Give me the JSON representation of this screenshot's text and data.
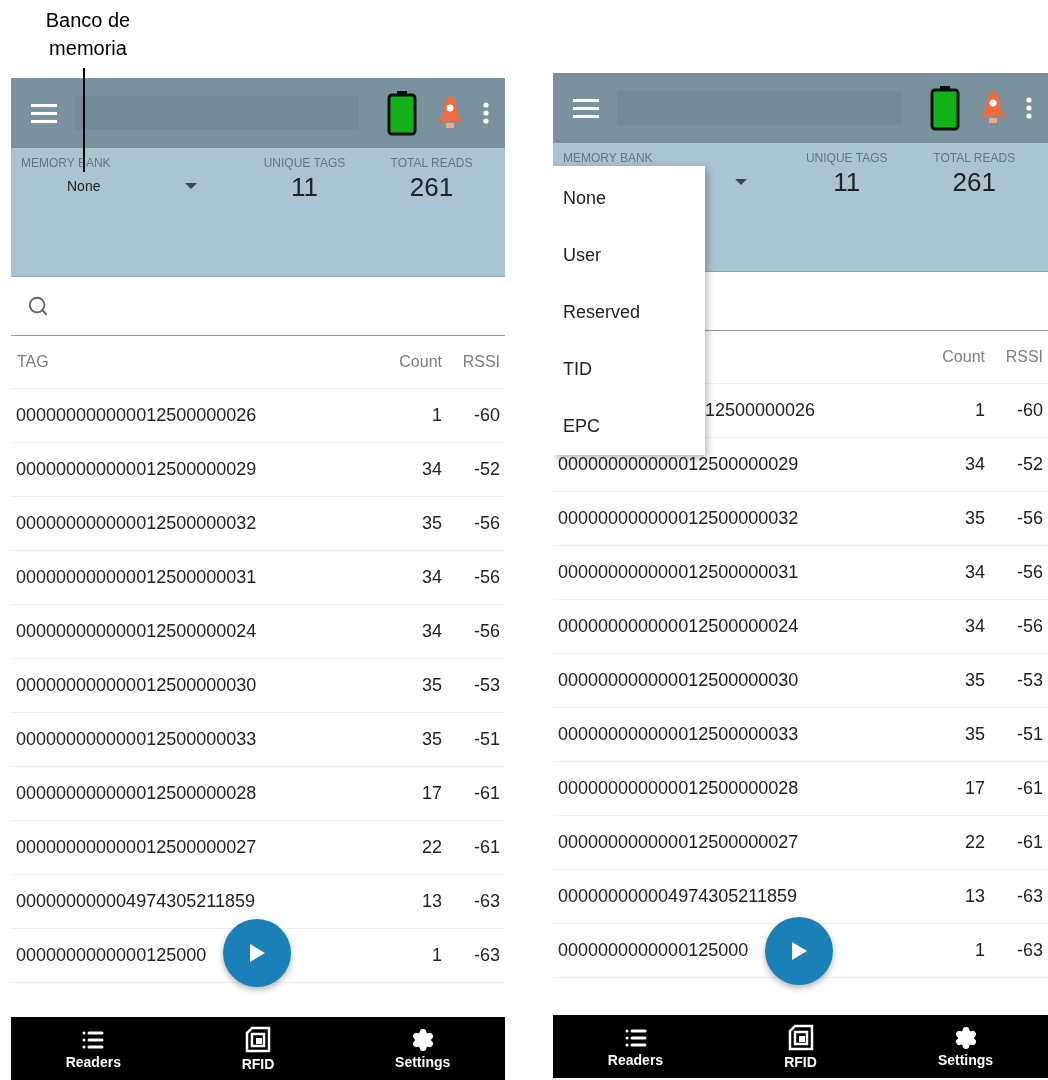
{
  "annotation": {
    "label": "Banco de memoria"
  },
  "screens": [
    {
      "memory_bank": {
        "label": "MEMORY BANK",
        "value": "None"
      },
      "unique_tags": {
        "label": "UNIQUE TAGS",
        "value": "11"
      },
      "total_reads": {
        "label": "TOTAL READS",
        "value": "261"
      },
      "columns": {
        "tag": "TAG",
        "count": "Count",
        "rssi": "RSSI"
      },
      "rows": [
        {
          "tag": "000000000000012500000026",
          "count": "1",
          "rssi": "-60"
        },
        {
          "tag": "000000000000012500000029",
          "count": "34",
          "rssi": "-52"
        },
        {
          "tag": "000000000000012500000032",
          "count": "35",
          "rssi": "-56"
        },
        {
          "tag": "000000000000012500000031",
          "count": "34",
          "rssi": "-56"
        },
        {
          "tag": "000000000000012500000024",
          "count": "34",
          "rssi": "-56"
        },
        {
          "tag": "000000000000012500000030",
          "count": "35",
          "rssi": "-53"
        },
        {
          "tag": "000000000000012500000033",
          "count": "35",
          "rssi": "-51"
        },
        {
          "tag": "000000000000012500000028",
          "count": "17",
          "rssi": "-61"
        },
        {
          "tag": "000000000000012500000027",
          "count": "22",
          "rssi": "-61"
        },
        {
          "tag": "000000000004974305211859",
          "count": "13",
          "rssi": "-63"
        },
        {
          "tag": "0000000000000125000",
          "count": "1",
          "rssi": "-63"
        }
      ],
      "nav": [
        {
          "label": "Readers",
          "kind": "list"
        },
        {
          "label": "RFID",
          "kind": "chip"
        },
        {
          "label": "Settings",
          "kind": "gear"
        }
      ]
    },
    {
      "memory_bank": {
        "label": "MEMORY BANK"
      },
      "unique_tags": {
        "label": "UNIQUE TAGS",
        "value": "11"
      },
      "total_reads": {
        "label": "TOTAL READS",
        "value": "261"
      },
      "columns": {
        "count": "Count",
        "rssi": "RSSI"
      },
      "dropdown": {
        "items": [
          "None",
          "User",
          "Reserved",
          "TID",
          "EPC"
        ]
      },
      "rows": [
        {
          "tag": "12500000026",
          "count": "1",
          "rssi": "-60"
        },
        {
          "tag": "000000000000012500000029",
          "count": "34",
          "rssi": "-52"
        },
        {
          "tag": "000000000000012500000032",
          "count": "35",
          "rssi": "-56"
        },
        {
          "tag": "000000000000012500000031",
          "count": "34",
          "rssi": "-56"
        },
        {
          "tag": "000000000000012500000024",
          "count": "34",
          "rssi": "-56"
        },
        {
          "tag": "000000000000012500000030",
          "count": "35",
          "rssi": "-53"
        },
        {
          "tag": "000000000000012500000033",
          "count": "35",
          "rssi": "-51"
        },
        {
          "tag": "000000000000012500000028",
          "count": "17",
          "rssi": "-61"
        },
        {
          "tag": "000000000000012500000027",
          "count": "22",
          "rssi": "-61"
        },
        {
          "tag": "000000000004974305211859",
          "count": "13",
          "rssi": "-63"
        },
        {
          "tag": "0000000000000125000",
          "count": "1",
          "rssi": "-63"
        }
      ],
      "nav": [
        {
          "label": "Readers",
          "kind": "list"
        },
        {
          "label": "RFID",
          "kind": "chip"
        },
        {
          "label": "Settings",
          "kind": "gear"
        }
      ]
    }
  ]
}
